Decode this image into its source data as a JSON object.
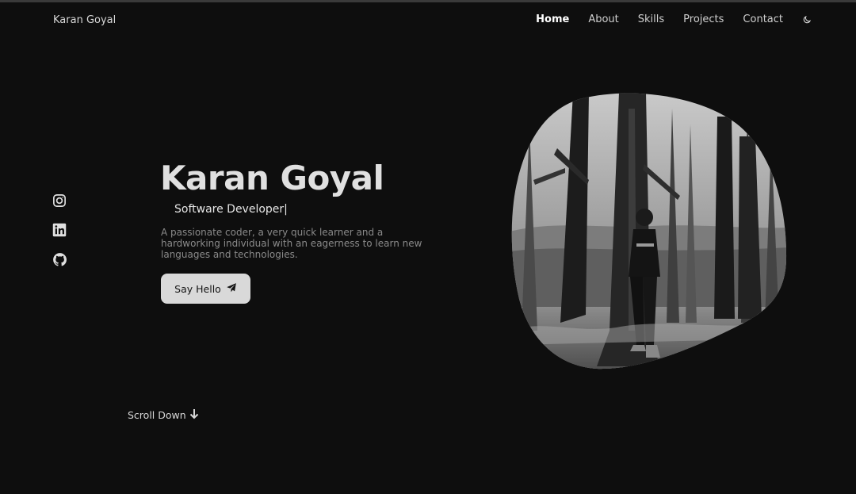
{
  "header": {
    "brand": "Karan Goyal",
    "nav": [
      {
        "label": "Home",
        "active": true
      },
      {
        "label": "About",
        "active": false
      },
      {
        "label": "Skills",
        "active": false
      },
      {
        "label": "Projects",
        "active": false
      },
      {
        "label": "Contact",
        "active": false
      }
    ],
    "theme_icon": "moon-icon"
  },
  "social": [
    "instagram-icon",
    "linkedin-icon",
    "github-icon"
  ],
  "hero": {
    "title": "Karan Goyal",
    "subtitle": "Software Developer|",
    "description": "A passionate coder, a very quick learner and a hardworking individual with an eagerness to learn new languages and technologies.",
    "button_label": "Say Hello",
    "button_icon": "send-icon"
  },
  "scroll": {
    "label": "Scroll Down",
    "icon": "arrow-down-icon"
  },
  "colors": {
    "background": "#0e0e0e",
    "button": "#d9d9d9",
    "text": "#d6d6d6"
  }
}
